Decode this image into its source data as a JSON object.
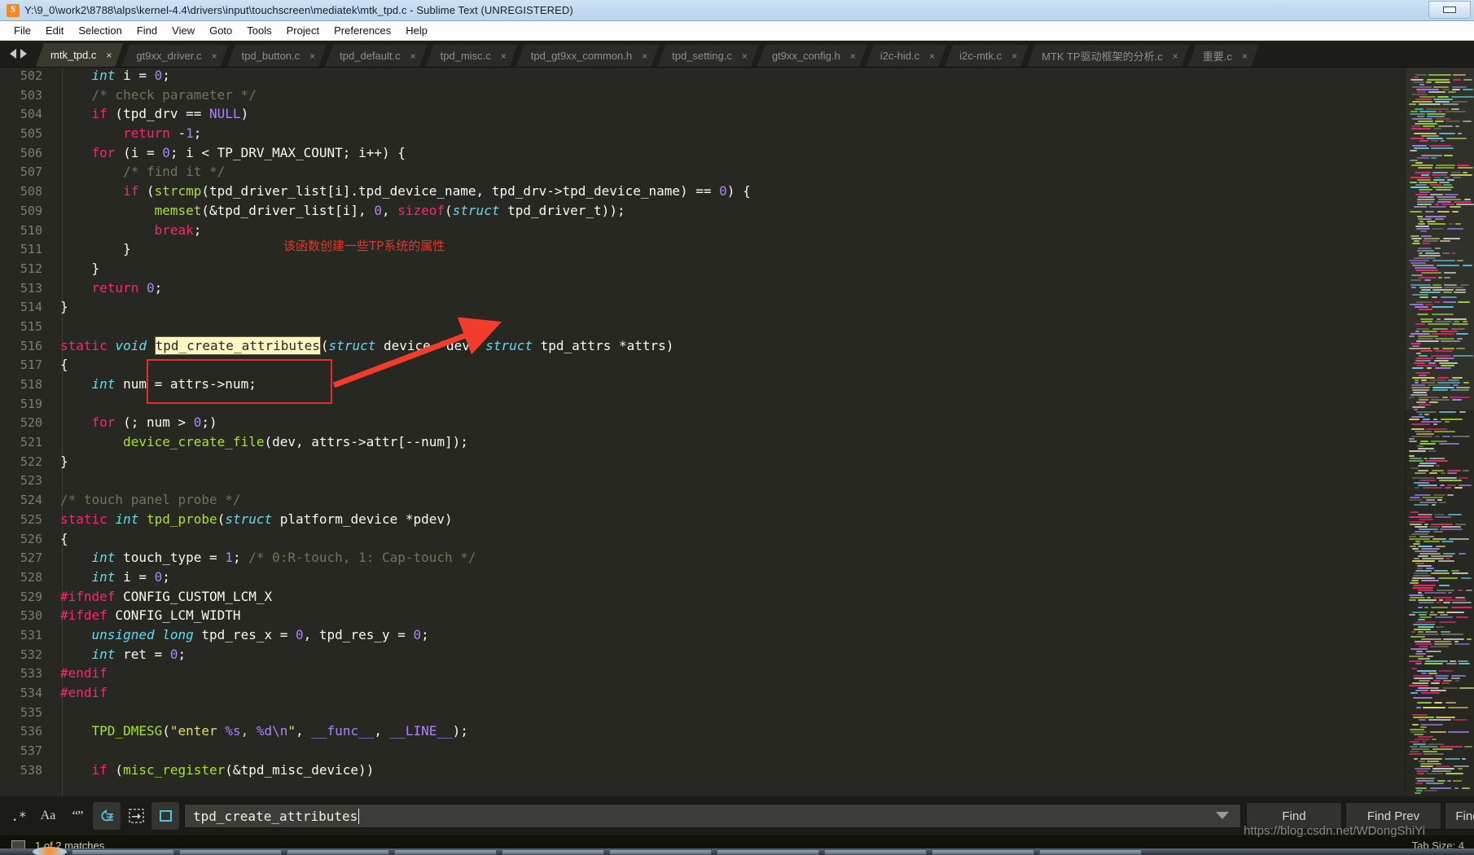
{
  "window": {
    "title": "Y:\\9_0\\work2\\8788\\alps\\kernel-4.4\\drivers\\input\\touchscreen\\mediatek\\mtk_tpd.c - Sublime Text (UNREGISTERED)",
    "app_icon": "sublime-text-icon",
    "minimize_label": "",
    "blurred_right_text": "· ··· ··· ··· ·· ···"
  },
  "menubar": {
    "items": [
      "File",
      "Edit",
      "Selection",
      "Find",
      "View",
      "Goto",
      "Tools",
      "Project",
      "Preferences",
      "Help"
    ]
  },
  "tabs": {
    "prev_icon": "chevron-left-icon",
    "next_icon": "chevron-right-icon",
    "close_glyph": "×",
    "items": [
      {
        "label": "mtk_tpd.c",
        "active": true
      },
      {
        "label": "gt9xx_driver.c",
        "active": false
      },
      {
        "label": "tpd_button.c",
        "active": false
      },
      {
        "label": "tpd_default.c",
        "active": false
      },
      {
        "label": "tpd_misc.c",
        "active": false
      },
      {
        "label": "tpd_gt9xx_common.h",
        "active": false
      },
      {
        "label": "tpd_setting.c",
        "active": false
      },
      {
        "label": "gt9xx_config.h",
        "active": false
      },
      {
        "label": "i2c-hid.c",
        "active": false
      },
      {
        "label": "i2c-mtk.c",
        "active": false
      },
      {
        "label": "MTK TP驱动框架的分析.c",
        "active": false
      },
      {
        "label": "重要.c",
        "active": false
      }
    ]
  },
  "editor": {
    "first_line": 502,
    "annotation": "该函数创建一些TP系统的属性",
    "highlight_word": "tpd_create_attributes",
    "lines": [
      {
        "n": 502,
        "text": "    int i = 0;"
      },
      {
        "n": 503,
        "text": "    /* check parameter */"
      },
      {
        "n": 504,
        "text": "    if (tpd_drv == NULL)"
      },
      {
        "n": 505,
        "text": "        return -1;"
      },
      {
        "n": 506,
        "text": "    for (i = 0; i < TP_DRV_MAX_COUNT; i++) {"
      },
      {
        "n": 507,
        "text": "        /* find it */"
      },
      {
        "n": 508,
        "text": "        if (strcmp(tpd_driver_list[i].tpd_device_name, tpd_drv->tpd_device_name) == 0) {"
      },
      {
        "n": 509,
        "text": "            memset(&tpd_driver_list[i], 0, sizeof(struct tpd_driver_t));"
      },
      {
        "n": 510,
        "text": "            break;"
      },
      {
        "n": 511,
        "text": "        }"
      },
      {
        "n": 512,
        "text": "    }"
      },
      {
        "n": 513,
        "text": "    return 0;"
      },
      {
        "n": 514,
        "text": "}"
      },
      {
        "n": 515,
        "text": ""
      },
      {
        "n": 516,
        "text": "static void tpd_create_attributes(struct device *dev, struct tpd_attrs *attrs)"
      },
      {
        "n": 517,
        "text": "{"
      },
      {
        "n": 518,
        "text": "    int num = attrs->num;"
      },
      {
        "n": 519,
        "text": ""
      },
      {
        "n": 520,
        "text": "    for (; num > 0;)"
      },
      {
        "n": 521,
        "text": "        device_create_file(dev, attrs->attr[--num]);"
      },
      {
        "n": 522,
        "text": "}"
      },
      {
        "n": 523,
        "text": ""
      },
      {
        "n": 524,
        "text": "/* touch panel probe */"
      },
      {
        "n": 525,
        "text": "static int tpd_probe(struct platform_device *pdev)"
      },
      {
        "n": 526,
        "text": "{"
      },
      {
        "n": 527,
        "text": "    int touch_type = 1; /* 0:R-touch, 1: Cap-touch */"
      },
      {
        "n": 528,
        "text": "    int i = 0;"
      },
      {
        "n": 529,
        "text": "#ifndef CONFIG_CUSTOM_LCM_X"
      },
      {
        "n": 530,
        "text": "#ifdef CONFIG_LCM_WIDTH"
      },
      {
        "n": 531,
        "text": "    unsigned long tpd_res_x = 0, tpd_res_y = 0;"
      },
      {
        "n": 532,
        "text": "    int ret = 0;"
      },
      {
        "n": 533,
        "text": "#endif"
      },
      {
        "n": 534,
        "text": "#endif"
      },
      {
        "n": 535,
        "text": ""
      },
      {
        "n": 536,
        "text": "    TPD_DMESG(\"enter %s, %d\\n\", __func__, __LINE__);"
      },
      {
        "n": 537,
        "text": ""
      },
      {
        "n": 538,
        "text": "    if (misc_register(&tpd_misc_device))"
      }
    ]
  },
  "findbar": {
    "toggles": [
      {
        "name": "regex-toggle",
        "glyph": ".*",
        "active": false
      },
      {
        "name": "case-sensitive-toggle",
        "glyph": "Aa",
        "active": false
      },
      {
        "name": "whole-word-toggle",
        "glyph": "“”",
        "active": false
      },
      {
        "name": "wrap-toggle",
        "glyph": "↺",
        "active": true
      },
      {
        "name": "in-selection-toggle",
        "glyph": "⬚",
        "active": false
      },
      {
        "name": "highlight-results-toggle",
        "glyph": "□",
        "active": true
      }
    ],
    "input_value": "tpd_create_attributes",
    "input_placeholder": "Find",
    "dropdown_icon": "chevron-down-icon",
    "buttons": [
      "Find",
      "Find Prev",
      "Find All"
    ]
  },
  "statusbar": {
    "icon": "panel-icon",
    "matches": "1 of 2 matches",
    "right_text": "Tab Size: 4",
    "watermark": "https://blog.csdn.net/WDongShiYi"
  },
  "colors": {
    "background": "#272822",
    "keyword": "#f92672",
    "type": "#66d9ef",
    "function": "#a6e22e",
    "number": "#ae81ff",
    "comment": "#75715e",
    "string": "#e6db74",
    "annotation_red": "#e0392c",
    "selection_bg": "#fdf6c3",
    "titlebar": "#c2d9f0"
  }
}
